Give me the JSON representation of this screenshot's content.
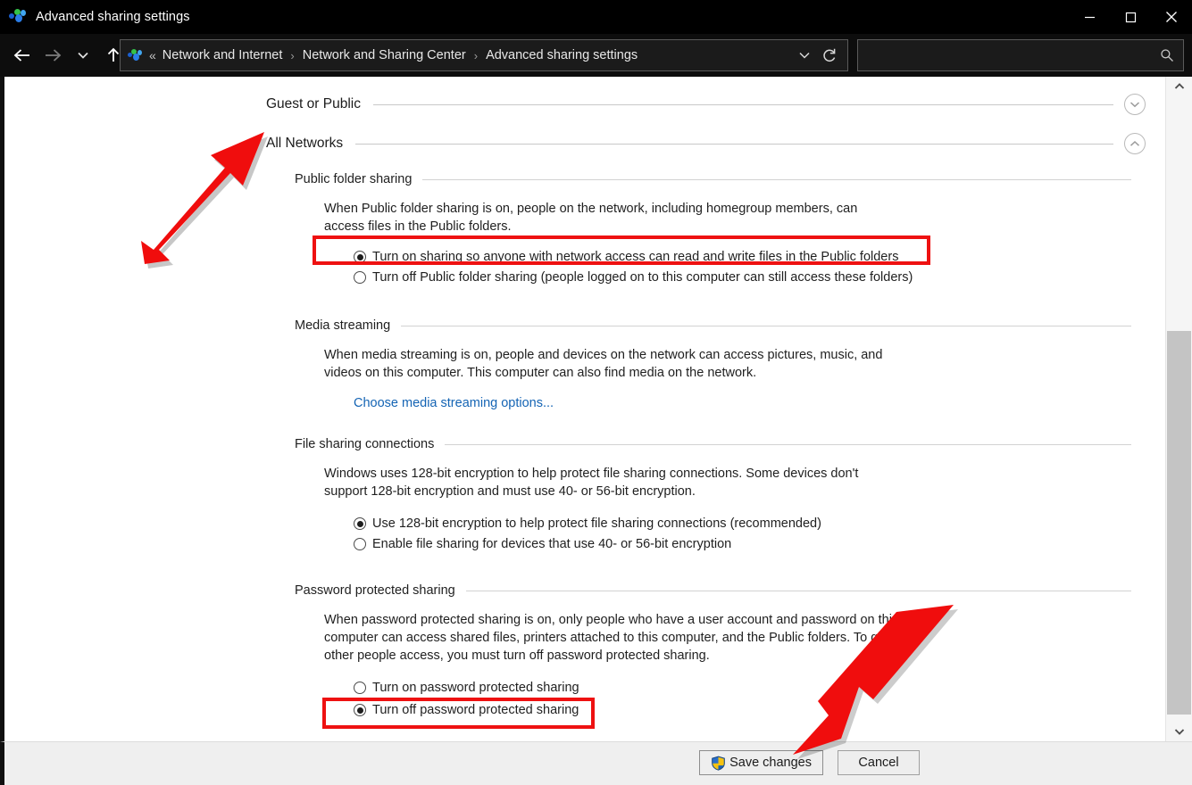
{
  "window": {
    "title": "Advanced sharing settings",
    "icon": "network-sharing-icon",
    "minimize_label": "Minimize",
    "maximize_label": "Maximize",
    "close_label": "Close"
  },
  "nav": {
    "back_label": "Back",
    "forward_label": "Forward",
    "recent_label": "Recent locations",
    "up_label": "Up one level",
    "dropdown_label": "Previous locations",
    "refresh_label": "Refresh"
  },
  "address": {
    "leading_chevrons": "«",
    "separator": "›",
    "crumbs": [
      "Network and Internet",
      "Network and Sharing Center",
      "Advanced sharing settings"
    ]
  },
  "search": {
    "value": "",
    "placeholder": "",
    "icon": "search-icon"
  },
  "profiles": [
    {
      "id": "guest-or-public",
      "title": "Guest or Public",
      "expanded": false,
      "chevron": "chevron-down-icon"
    },
    {
      "id": "all-networks",
      "title": "All Networks",
      "expanded": true,
      "chevron": "chevron-up-icon"
    }
  ],
  "sections": [
    {
      "id": "public-folder-sharing",
      "title": "Public folder sharing",
      "description": "When Public folder sharing is on, people on the network, including homegroup members, can access files in the Public folders.",
      "options": [
        {
          "label": "Turn on sharing so anyone with network access can read and write files in the Public folders",
          "selected": true,
          "highlighted": true
        },
        {
          "label": "Turn off Public folder sharing (people logged on to this computer can still access these folders)",
          "selected": false,
          "highlighted": false
        }
      ]
    },
    {
      "id": "media-streaming",
      "title": "Media streaming",
      "description": "When media streaming is on, people and devices on the network can access pictures, music, and videos on this computer. This computer can also find media on the network.",
      "link": "Choose media streaming options...",
      "options": []
    },
    {
      "id": "file-sharing-connections",
      "title": "File sharing connections",
      "description": "Windows uses 128-bit encryption to help protect file sharing connections. Some devices don't support 128-bit encryption and must use 40- or 56-bit encryption.",
      "options": [
        {
          "label": "Use 128-bit encryption to help protect file sharing connections (recommended)",
          "selected": true,
          "highlighted": false
        },
        {
          "label": "Enable file sharing for devices that use 40- or 56-bit encryption",
          "selected": false,
          "highlighted": false
        }
      ]
    },
    {
      "id": "password-protected-sharing",
      "title": "Password protected sharing",
      "description": "When password protected sharing is on, only people who have a user account and password on this computer can access shared files, printers attached to this computer, and the Public folders. To give other people access, you must turn off password protected sharing.",
      "options": [
        {
          "label": "Turn on password protected sharing",
          "selected": false,
          "highlighted": false
        },
        {
          "label": "Turn off password protected sharing",
          "selected": true,
          "highlighted": true
        }
      ]
    }
  ],
  "footer": {
    "save_label": "Save changes",
    "save_icon": "uac-shield-icon",
    "cancel_label": "Cancel"
  },
  "scrollbar": {
    "up_label": "Scroll up",
    "down_label": "Scroll down",
    "thumb_label": "Vertical scroll thumb"
  },
  "annotations": {
    "highlight_color": "#ee1111",
    "arrow_color": "#f00d0d",
    "arrow_to_all_networks": "red-arrow-pointing-to-all-networks",
    "arrow_to_save": "red-arrow-pointing-to-save-changes",
    "box_public_folder": "red-box-around-turn-on-sharing-option",
    "box_password": "red-box-around-turn-off-password-protected-sharing-option"
  }
}
